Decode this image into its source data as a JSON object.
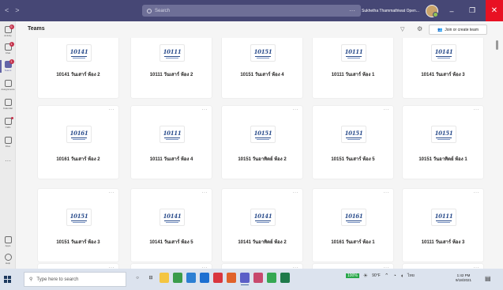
{
  "titlebar": {
    "search_placeholder": "Search",
    "more": "···",
    "user_name": "Sukhetha Thammathiwat Open...",
    "minimize": "–",
    "maximize": "❐",
    "close": "✕",
    "back": "<",
    "forward": ">"
  },
  "rail": {
    "items": [
      {
        "label": "Activity",
        "badge": "6"
      },
      {
        "label": "Chat",
        "badge": "1"
      },
      {
        "label": "Teams",
        "badge": "1"
      },
      {
        "label": "Assignments"
      },
      {
        "label": "Calendar"
      },
      {
        "label": "Calls"
      },
      {
        "label": "Files"
      }
    ],
    "more": "···",
    "apps": "Apps",
    "help": "Help"
  },
  "header": {
    "title": "Teams",
    "join_label": "Join or create team"
  },
  "logo_text": [
    "10141",
    "10111",
    "10151",
    "10111",
    "10141",
    "10161",
    "10111",
    "10151",
    "10151",
    "10151",
    "10151",
    "10141",
    "10141",
    "10161",
    "10111"
  ],
  "teams": [
    "10141 วันเสาร์ ห้อง 2",
    "10111 วันเสาร์ ห้อง 2",
    "10151 วันเสาร์ ห้อง 4",
    "10111 วันเสาร์ ห้อง 1",
    "10141 วันเสาร์ ห้อง 3",
    "10161 วันเสาร์ ห้อง 2",
    "10111 วันเสาร์ ห้อง 4",
    "10151 วันอาทิตย์ ห้อง 2",
    "10151 วันเสาร์ ห้อง 5",
    "10151 วันอาทิตย์ ห้อง 1",
    "10151 วันเสาร์ ห้อง 3",
    "10141 วันเสาร์ ห้อง 5",
    "10141 วันอาทิตย์ ห้อง 2",
    "10161 วันเสาร์ ห้อง 1",
    "10111 วันเสาร์ ห้อง 3"
  ],
  "card_more": "···",
  "taskbar": {
    "search_placeholder": "Type here to search",
    "battery": "100%",
    "temperature": "90°F",
    "lang": "ไทย",
    "time": "1:42 PM",
    "date": "9/18/2021"
  },
  "colors": {
    "titlebar": "#464775",
    "accent": "#6264a7",
    "close": "#e81123",
    "badge": "#c4314b",
    "logo": "#2b4d8c"
  }
}
